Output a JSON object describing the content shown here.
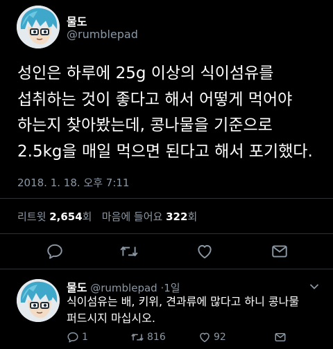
{
  "tweet": {
    "author_name": "물도",
    "author_handle": "@rumblepad",
    "lines": [
      "성인은 하루에 25g 이상의 식이섬유를",
      "섭취하는 것이 좋다고 해서 어떻게 먹어야",
      "하는지 찾아봤는데, 콩나물을 기준으로",
      "2.5kg을 매일 먹으면 된다고 해서 포기했다."
    ],
    "timestamp": "2018. 1. 18. 오후 7:11",
    "retweets_label": "리트윗",
    "retweets_count": "2,654",
    "retweets_unit": "회",
    "likes_label": "마음에 들어요",
    "likes_count": "322",
    "likes_unit": "회"
  },
  "actions": {
    "reply_icon": "speech-bubble-icon",
    "retweet_icon": "retweet-arrows-icon",
    "like_icon": "heart-icon",
    "dm_icon": "envelope-icon"
  },
  "reply": {
    "author_name": "물도",
    "author_handle": "@rumblepad",
    "separator": "·",
    "age": "1일",
    "lines": [
      "식이섬유는 배, 키위, 견과류에 많다고 하니 콩나물",
      "퍼드시지 마십시오."
    ],
    "reply_count": "1",
    "retweet_count": "816",
    "like_count": "92"
  },
  "colors": {
    "background": "#000000",
    "text": "#ffffff",
    "muted": "#8b98a5",
    "divider": "#2f3336"
  }
}
